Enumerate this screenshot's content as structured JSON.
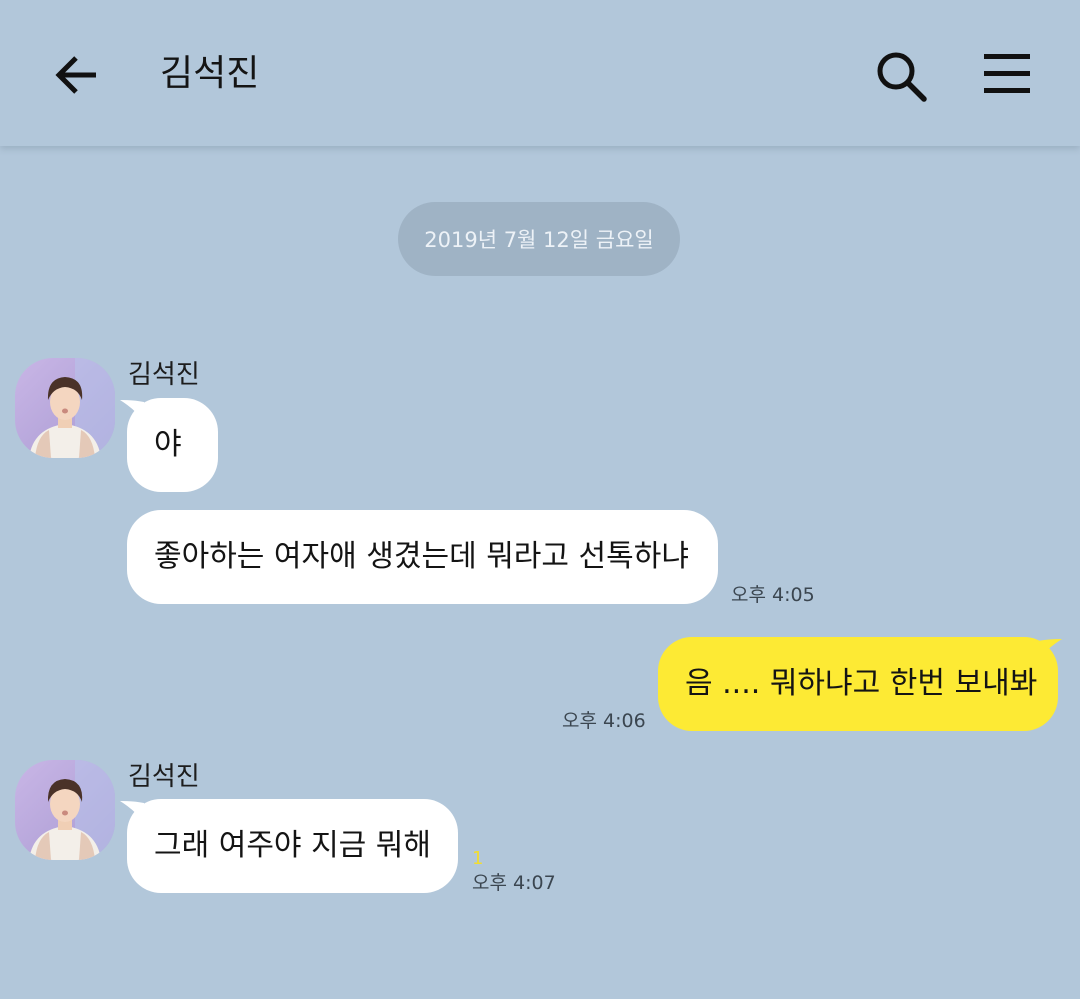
{
  "header": {
    "title": "김석진",
    "back_icon": "arrow-left-icon",
    "search_icon": "search-icon",
    "menu_icon": "hamburger-menu-icon"
  },
  "date_divider": "2019년 7월 12일 금요일",
  "messages": [
    {
      "sender": "김석진",
      "text": "야",
      "time": "",
      "incoming": true
    },
    {
      "sender": "",
      "text": "좋아하는 여자애 생겼는데 뭐라고 선톡하냐",
      "time": "오후 4:05",
      "incoming": true
    },
    {
      "sender": "",
      "text": "음 .... 뭐하냐고 한번 보내봐",
      "time": "오후 4:06",
      "incoming": false
    },
    {
      "sender": "김석진",
      "text": "그래 여주야 지금 뭐해",
      "time": "오후 4:07",
      "unread": "1",
      "incoming": true
    }
  ],
  "colors": {
    "background": "#b2c7da",
    "incoming_bubble": "#ffffff",
    "outgoing_bubble": "#fdea34",
    "date_pill": "#9fb3c5",
    "unread": "#f2dd2f"
  }
}
